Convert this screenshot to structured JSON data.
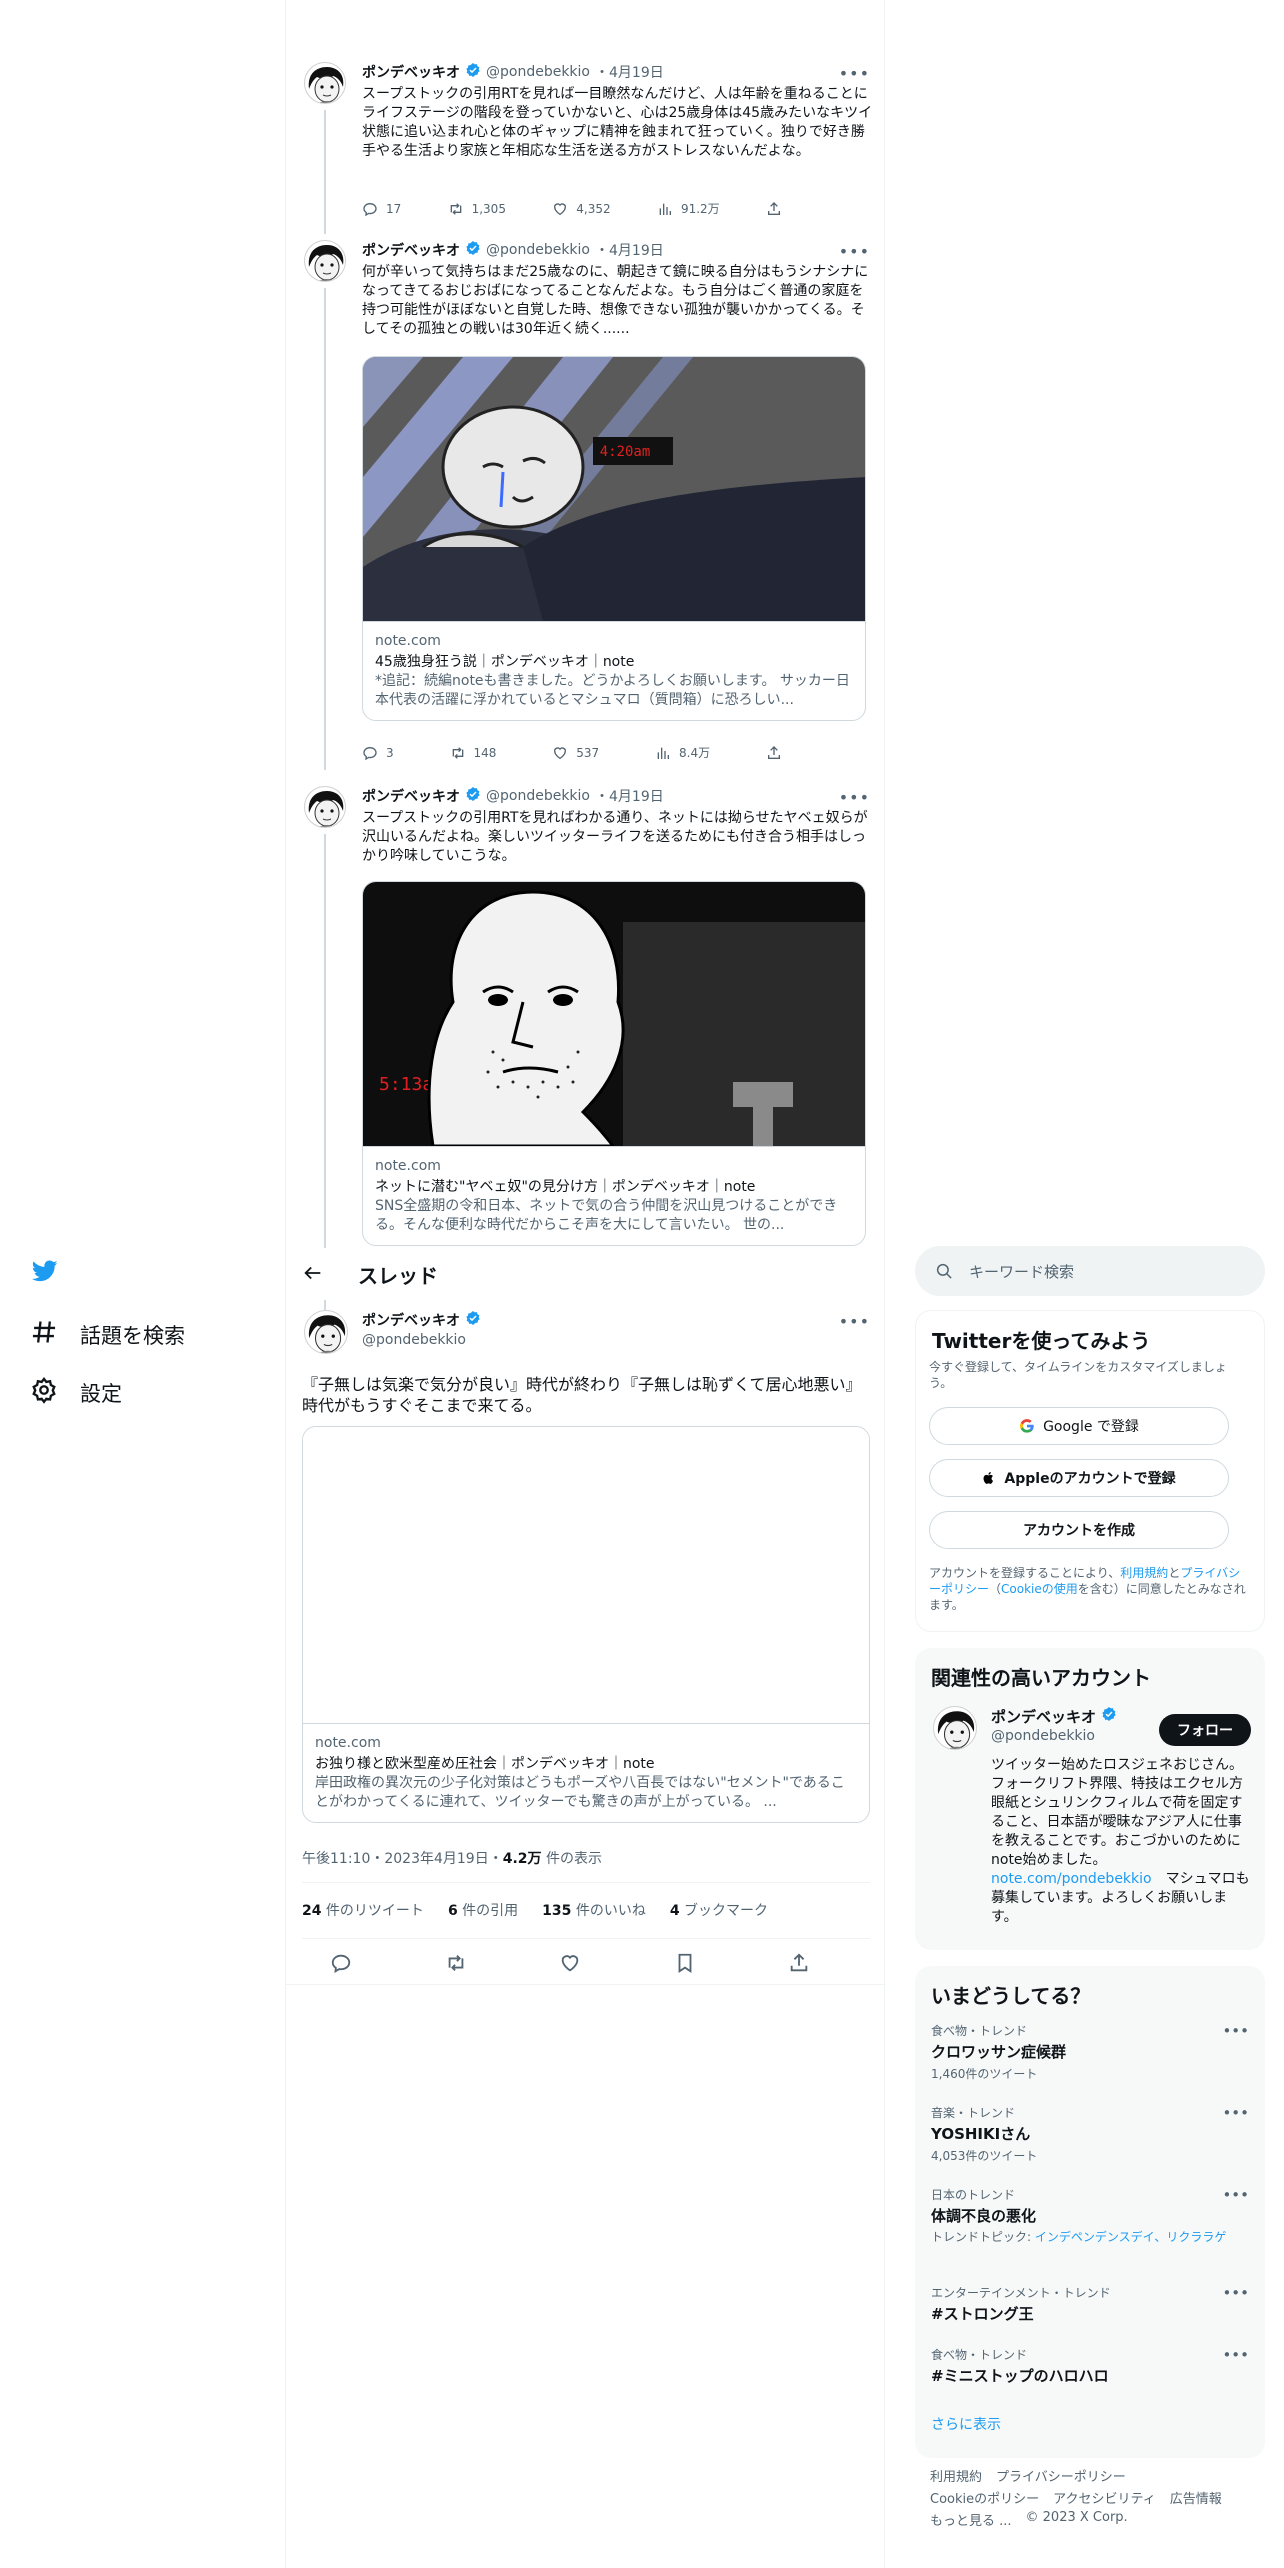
{
  "nav": {
    "explore_label": "話題を検索",
    "settings_label": "設定"
  },
  "tweets": [
    {
      "name": "ポンデベッキオ",
      "handle": "@pondebekkio",
      "date": "・4月19日",
      "text": "スープストックの引用RTを見れば一目瞭然なんだけど、人は年齢を重ねることにライフステージの階段を登っていかないと、心は25歳身体は45歳みたいなキツイ状態に追い込まれ心と体のギャップに精神を蝕まれて狂っていく。独りで好き勝手やる生活より家族と年相応な生活を送る方がストレスないんだよな。",
      "replies": "17",
      "retweets": "1,305",
      "likes": "4,352",
      "views": "91.2万"
    },
    {
      "name": "ポンデベッキオ",
      "handle": "@pondebekkio",
      "date": "・4月19日",
      "text": "何が辛いって気持ちはまだ25歳なのに、朝起きて鏡に映る自分はもうシナシナになってきてるおじおばになってることなんだよな。もう自分はごく普通の家庭を持つ可能性がほぼないと自覚した時、想像できない孤独が襲いかかってくる。そしてその孤独との戦いは30年近く続く......",
      "card": {
        "domain": "note.com",
        "title": "45歳独身狂う説｜ポンデベッキオ｜note",
        "desc": "*追記：続編noteも書きました。どうかよろしくお願いします。 サッカー日本代表の活躍に浮かれているとマシュマロ（質問箱）に恐ろしい...",
        "clock": "4:20am"
      },
      "replies": "3",
      "retweets": "148",
      "likes": "537",
      "views": "8.4万"
    },
    {
      "name": "ポンデベッキオ",
      "handle": "@pondebekkio",
      "date": "・4月19日",
      "text": "スープストックの引用RTを見ればわかる通り、ネットには拗らせたヤベェ奴らが沢山いるんだよね。楽しいツイッターライフを送るためにも付き合う相手はしっかり吟味していこうな。",
      "card": {
        "domain": "note.com",
        "title": "ネットに潜む\"ヤベェ奴\"の見分け方｜ポンデベッキオ｜note",
        "desc": "SNS全盛期の令和日本、ネットで気の合う仲間を沢山見つけることができる。そんな便利な時代だからこそ声を大にして言いたい。 世の...",
        "clock": "5:13am"
      }
    }
  ],
  "thread_header": {
    "title": "スレッド"
  },
  "main_tweet": {
    "name": "ポンデベッキオ",
    "handle": "@pondebekkio",
    "text": "『子無しは気楽で気分が良い』時代が終わり『子無しは恥ずくて居心地悪い』時代がもうすぐそこまで来てる。",
    "card": {
      "domain": "note.com",
      "title": "お独り様と欧米型産め圧社会｜ポンデベッキオ｜note",
      "desc": "岸田政権の異次元の少子化対策はどうもポーズや八百長ではない\"セメント\"であることがわかってくるに連れて、ツイッターでも驚きの声が上がっている。 ..."
    },
    "time": "午後11:10・2023年4月19日・",
    "views_count": "4.2万",
    "views_label": " 件の表示",
    "stats": [
      {
        "count": "24",
        "label": " 件のリツイート"
      },
      {
        "count": "6",
        "label": " 件の引用"
      },
      {
        "count": "135",
        "label": " 件のいいね"
      },
      {
        "count": "4",
        "label": " ブックマーク"
      }
    ]
  },
  "search": {
    "placeholder": "キーワード検索"
  },
  "signup": {
    "title": "Twitterを使ってみよう",
    "subtitle": "今すぐ登録して、タイムラインをカスタマイズしましょう。",
    "google_label": "Google で登録",
    "apple_label": "Appleのアカウントで登録",
    "create_label": "アカウントを作成",
    "legal_1": "アカウントを登録することにより、",
    "legal_terms": "利用規約",
    "legal_and": "と",
    "legal_privacy": "プライバシーポリシー",
    "legal_paren_open": "（",
    "legal_cookie": "Cookieの使用",
    "legal_2": "を含む）に同意したとみなされます。"
  },
  "related": {
    "title": "関連性の高いアカウント",
    "name": "ポンデベッキオ",
    "handle": "@pondebekkio",
    "follow_label": "フォロー",
    "bio_1": "ツイッター始めたロスジェネおじさん。フォークリフト界隈、特技はエクセル方眼紙とシュリンクフィルムで荷を固定すること、日本語が曖昧なアジア人に仕事を教えることです。おこづかいのためにnote始めました。",
    "bio_link": "note.com/pondebekkio",
    "bio_2": "　マシュマロも募集しています。よろしくお願いします。"
  },
  "trends": {
    "title": "いまどうしてる？",
    "items": [
      {
        "category": "食べ物・トレンド",
        "name": "クロワッサン症候群",
        "count": "1,460件のツイート"
      },
      {
        "category": "音楽・トレンド",
        "name": "YOSHIKIさん",
        "count": "4,053件のツイート"
      },
      {
        "category": "日本のトレンド",
        "name": "体調不良の悪化",
        "topics_label": "トレンドトピック: ",
        "topics": "インデペンデンスデイ、リクララゲ"
      },
      {
        "category": "エンターテインメント・トレンド",
        "name": "#ストロング王"
      },
      {
        "category": "食べ物・トレンド",
        "name": "#ミニストップのハロハロ"
      }
    ],
    "show_more": "さらに表示"
  },
  "footer": {
    "terms": "利用規約",
    "privacy": "プライバシーポリシー",
    "cookie": "Cookieのポリシー",
    "accessibility": "アクセシビリティ",
    "ads": "広告情報",
    "more": "もっと見る ...",
    "copyright": "© 2023 X Corp."
  },
  "colors": {
    "accent": "#1d9bf0",
    "text": "#0f1419",
    "muted": "#536471",
    "border": "#cfd9de"
  }
}
